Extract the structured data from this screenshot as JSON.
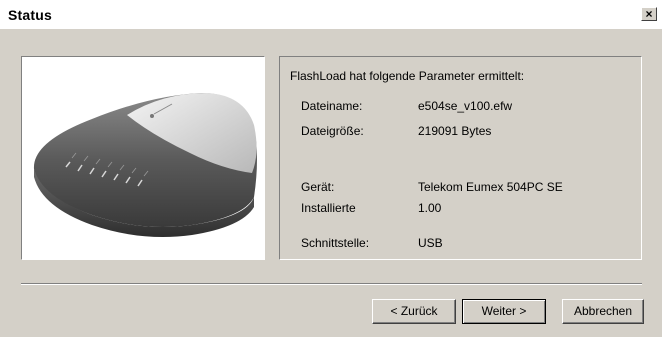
{
  "window": {
    "title": "Status",
    "close_glyph": "×",
    "close_icon": "close-icon"
  },
  "image": {
    "description_icon": "router-device-image"
  },
  "params": {
    "intro": "FlashLoad hat folgende Parameter ermittelt:",
    "rows": [
      {
        "label": "Dateiname:",
        "value": "e504se_v100.efw"
      },
      {
        "label": "Dateigröße:",
        "value": "219091 Bytes"
      },
      {
        "label": "Gerät:",
        "value": "Telekom Eumex 504PC SE"
      },
      {
        "label": "Installierte",
        "value": "1.00"
      },
      {
        "label": "Schnittstelle:",
        "value": "USB"
      }
    ]
  },
  "buttons": {
    "back": "< Zurück",
    "next": "Weiter >",
    "cancel": "Abbrechen"
  }
}
